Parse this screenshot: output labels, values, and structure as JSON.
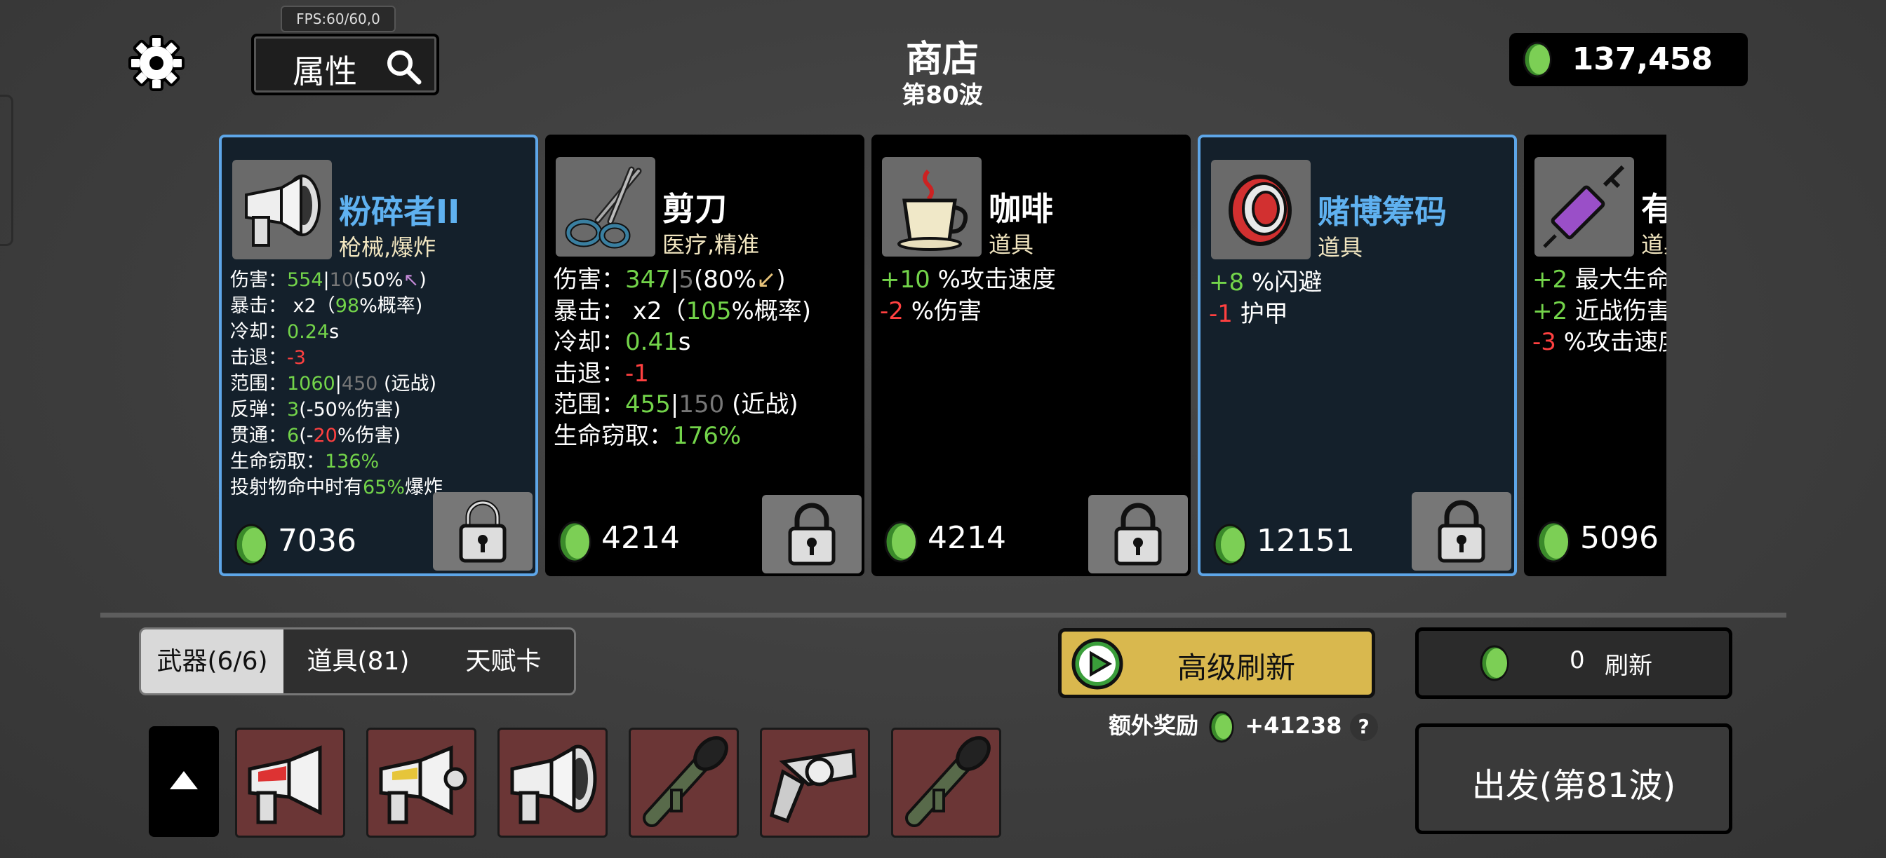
{
  "fps": "FPS:60/60,0",
  "header": {
    "attr_button": "属性",
    "title": "商店",
    "wave": "第80波",
    "money": "137,458"
  },
  "cards": [
    {
      "name": "粉碎者II",
      "tags": "枪械,爆炸",
      "selected": true,
      "price": "7036",
      "icon": "megaphone-gun-icon",
      "stats": {
        "dmg_label": "伤害：",
        "dmg": "554",
        "sep": "|",
        "dmg2": "10",
        "dmg_pct": "(50%",
        "dmg_end": ")",
        "crit_label": "暴击： x2（",
        "crit": "98",
        "crit_end": "%概率)",
        "cd_label": "冷却：",
        "cd": "0.24",
        "cd_unit": "s",
        "kb_label": "击退：",
        "kb": "-3",
        "range_label": "范围：",
        "range": "1060",
        "range2": "450",
        "range_type": " (远战)",
        "bounce_label": "反弹：",
        "bounce": "3",
        "bounce_end": "(-50%伤害)",
        "pierce_label": "贯通：",
        "pierce": "6",
        "pierce_mid": "(-",
        "pierce_val": "20",
        "pierce_end": "%伤害)",
        "ls_label": "生命窃取：",
        "ls": "136%",
        "proj_label": "投射物命中时有",
        "proj": "65%",
        "proj_end": "爆炸"
      }
    },
    {
      "name": "剪刀",
      "tags": "医疗,精准",
      "selected": false,
      "price": "4214",
      "icon": "scissors-icon",
      "stats": {
        "dmg_label": "伤害：",
        "dmg": "347",
        "sep": "|",
        "dmg2": "5",
        "dmg_pct": "(80%",
        "dmg_end": ")",
        "crit_label": "暴击： x2（",
        "crit": "105",
        "crit_end": "%概率)",
        "cd_label": "冷却：",
        "cd": "0.41",
        "cd_unit": "s",
        "kb_label": "击退：",
        "kb": "-1",
        "range_label": "范围：",
        "range": "455",
        "range2": "150",
        "range_type": " (近战)",
        "ls_label": "生命窃取：",
        "ls": "176%"
      }
    },
    {
      "name": "咖啡",
      "tags": "道具",
      "selected": false,
      "price": "4214",
      "icon": "coffee-cup-icon",
      "effects": [
        {
          "val": "+10",
          "cls": "g",
          "text": " %攻击速度"
        },
        {
          "val": "-2",
          "cls": "r",
          "text": " %伤害"
        }
      ]
    },
    {
      "name": "赌博筹码",
      "tags": "道具",
      "selected": true,
      "price": "12151",
      "icon": "poker-chip-icon",
      "effects": [
        {
          "val": "+8",
          "cls": "g",
          "text": " %闪避"
        },
        {
          "val": "-1",
          "cls": "r",
          "text": " 护甲"
        }
      ]
    },
    {
      "name": "有",
      "tags": "道具",
      "selected": false,
      "price": "5096",
      "icon": "syringe-icon",
      "effects": [
        {
          "val": "+2",
          "cls": "g",
          "text": " 最大生命值"
        },
        {
          "val": "+2",
          "cls": "g",
          "text": " 近战伤害"
        },
        {
          "val": "-3",
          "cls": "r",
          "text": " %攻击速度"
        }
      ]
    }
  ],
  "tabs": [
    "武器(6/6)",
    "道具(81)",
    "天赋卡"
  ],
  "inventory": [
    "red-megaphone-gun-icon",
    "yellow-megaphone-gun-icon",
    "megaphone-gun-icon",
    "rocket-launcher-icon",
    "revolver-icon",
    "rocket-launcher-icon"
  ],
  "advanced_refresh": "高级刷新",
  "bonus": {
    "label": "额外奖励",
    "value": "+41238",
    "help": "?"
  },
  "refresh": {
    "count": "0",
    "label": "刷新"
  },
  "go_button": "出发(第81波)",
  "colors": {
    "selected_border": "#5ea6e8",
    "green": "#73d44a",
    "red": "#ff4040",
    "gold_button": "#d9b84e",
    "slot": "#6b3636"
  }
}
